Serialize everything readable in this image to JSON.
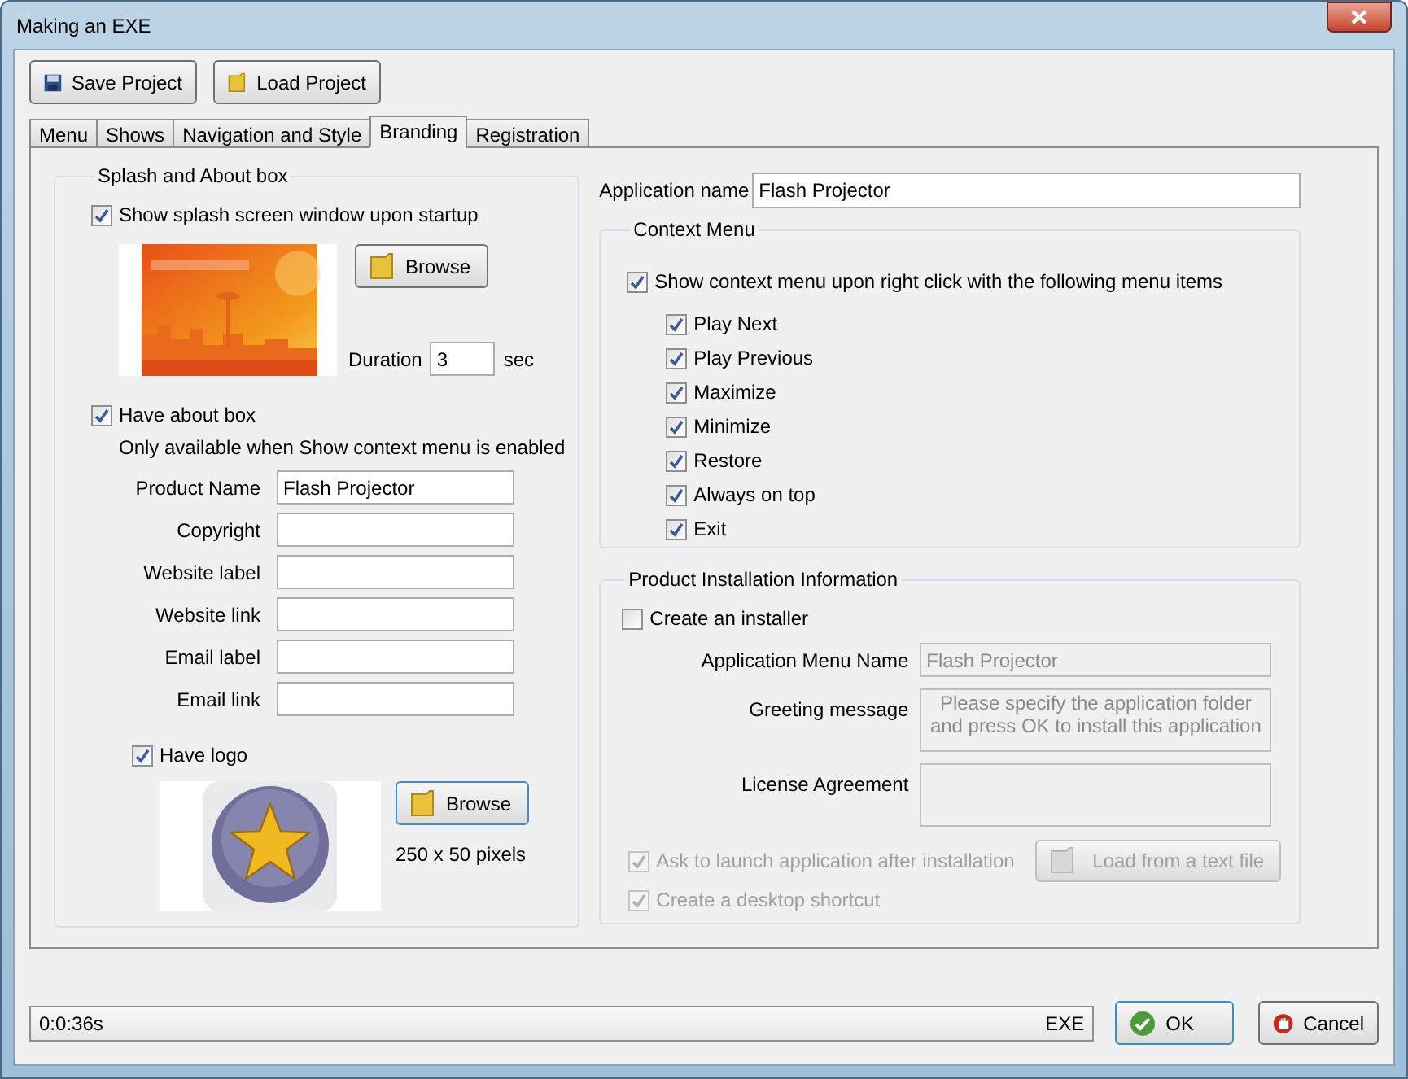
{
  "window": {
    "title": "Making an EXE"
  },
  "toolbar": [
    {
      "label": "Save Project",
      "kind": "save"
    },
    {
      "label": "Load Project",
      "kind": "load"
    }
  ],
  "tabs": [
    {
      "label": "Menu",
      "selected": false
    },
    {
      "label": "Shows",
      "selected": false
    },
    {
      "label": "Navigation and Style",
      "selected": false
    },
    {
      "label": "Branding",
      "selected": true
    },
    {
      "label": "Registration",
      "selected": false
    }
  ],
  "splash_group": {
    "title": "Splash and About box",
    "show_splash": {
      "label": "Show splash screen window upon startup",
      "checked": true
    },
    "browse_label": "Browse",
    "duration_label": "Duration",
    "duration_value": "3",
    "duration_unit": "sec",
    "have_about": {
      "label": "Have about box",
      "checked": true
    },
    "about_note": "Only available when Show context menu is enabled",
    "fields": [
      {
        "label": "Product Name",
        "value": "Flash Projector"
      },
      {
        "label": "Copyright"
      },
      {
        "label": "Website label"
      },
      {
        "label": "Website link"
      },
      {
        "label": "Email label"
      },
      {
        "label": "Email link"
      }
    ],
    "have_logo": {
      "label": "Have logo",
      "checked": true
    },
    "logo_browse_label": "Browse",
    "logo_size": "250 x 50 pixels"
  },
  "application_name": {
    "label": "Application name",
    "value": "Flash Projector"
  },
  "context_menu": {
    "title": "Context Menu",
    "show": {
      "label": "Show context menu upon right click with the following menu items",
      "checked": true
    },
    "items": [
      {
        "label": "Play Next",
        "checked": true
      },
      {
        "label": "Play Previous",
        "checked": true
      },
      {
        "label": "Maximize",
        "checked": true
      },
      {
        "label": "Minimize",
        "checked": true
      },
      {
        "label": "Restore",
        "checked": true
      },
      {
        "label": "Always on top",
        "checked": true
      },
      {
        "label": "Exit",
        "checked": true
      }
    ]
  },
  "installation": {
    "title": "Product Installation Information",
    "create_installer": {
      "label": "Create an installer",
      "checked": false
    },
    "fields": [
      {
        "label": "Application Menu Name",
        "value": "Flash Projector",
        "kind": "line",
        "disabled": true
      },
      {
        "label": "Greeting message",
        "value": "Please specify the application folder and press OK to install this application",
        "kind": "multi",
        "disabled": true
      },
      {
        "label": "License Agreement",
        "kind": "multi",
        "disabled": true
      }
    ],
    "launch": {
      "label": "Ask to launch application after installation",
      "checked": true,
      "disabled": true
    },
    "load_button": {
      "label": "Load from a text file",
      "disabled": true
    },
    "shortcut": {
      "label": "Create a desktop shortcut",
      "checked": true,
      "disabled": true
    }
  },
  "status_bar": {
    "elapsed": "0:0:36s",
    "mode": "EXE"
  },
  "buttons": [
    {
      "label": "OK",
      "kind": "ok",
      "focused": true
    },
    {
      "label": "Cancel",
      "kind": "cancel",
      "focused": false
    }
  ]
}
